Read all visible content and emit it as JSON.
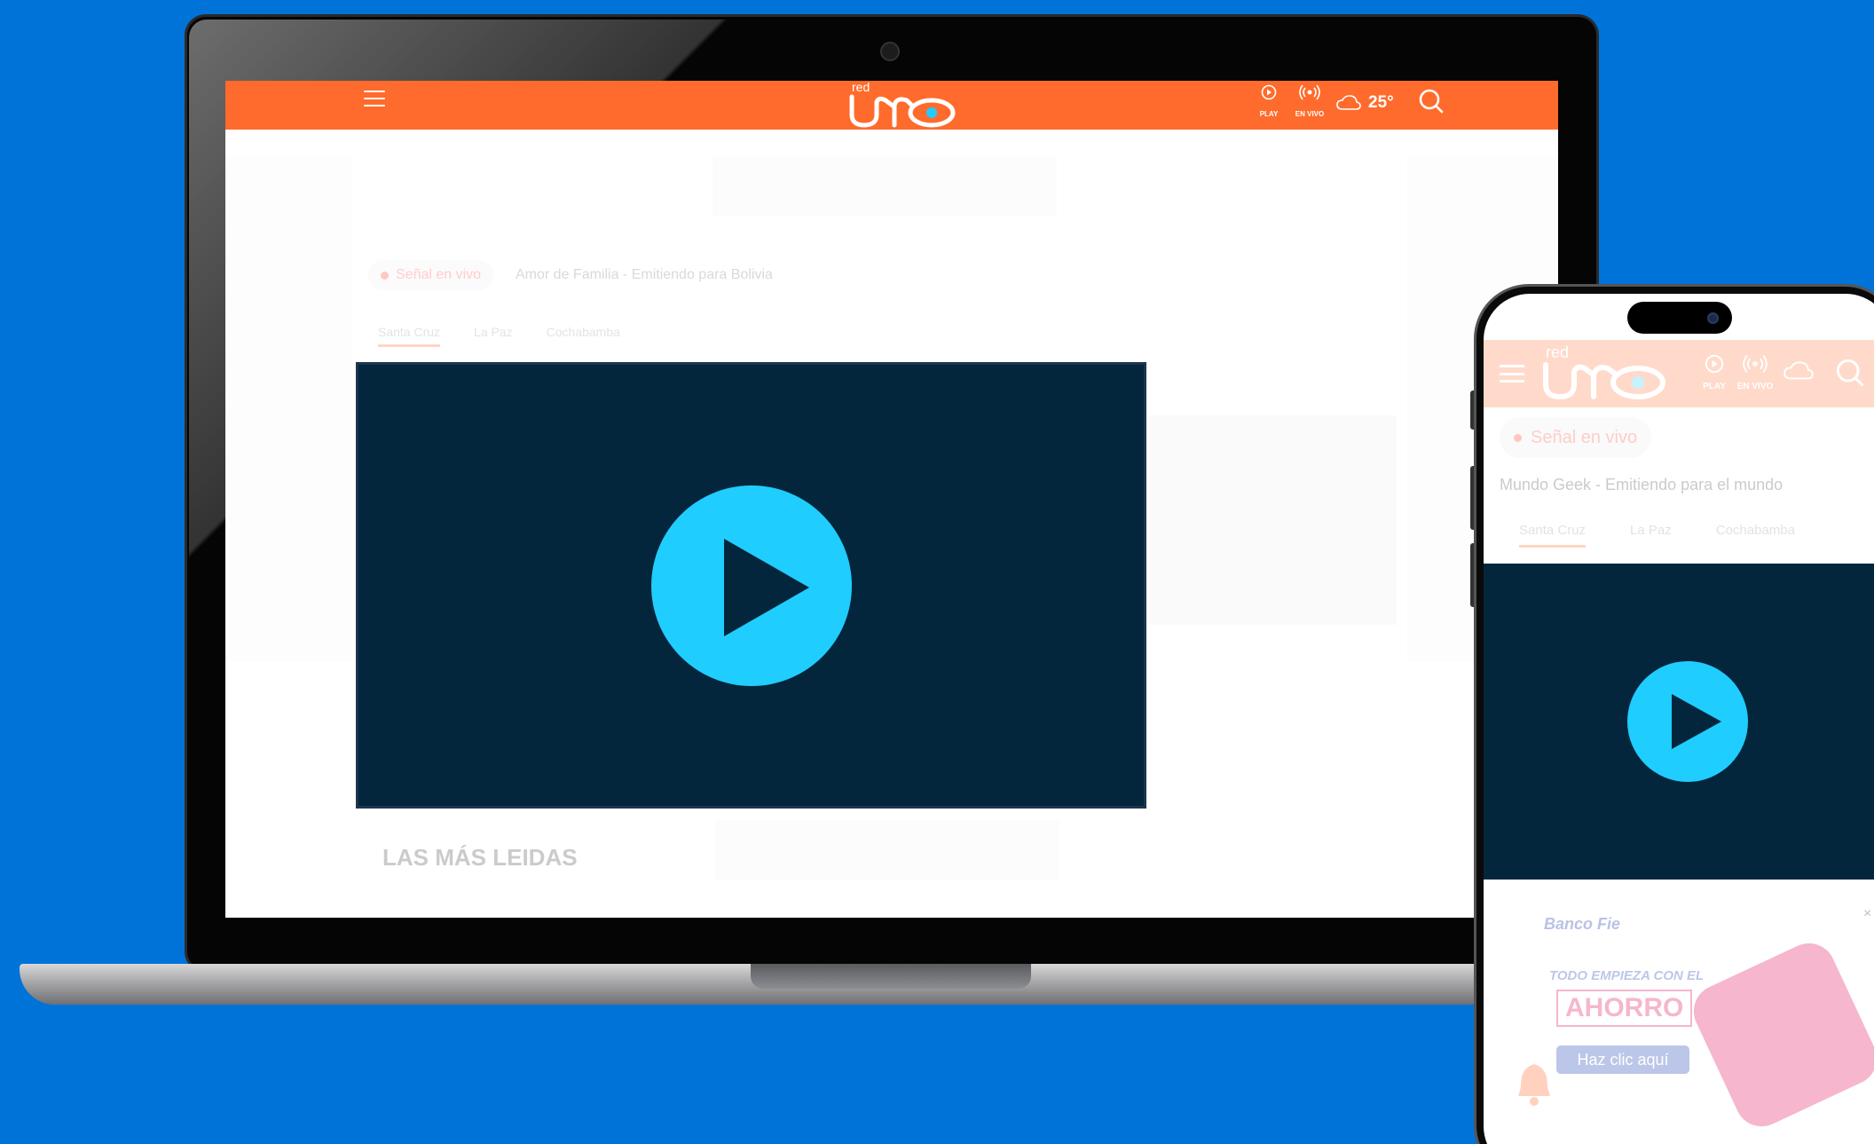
{
  "site": {
    "logo_top": "red",
    "logo_main": "uno",
    "nav": {
      "play_label": "PLAY",
      "live_label": "EN VIVO",
      "temperature": "25°"
    }
  },
  "desktop": {
    "live_badge": "Señal en vivo",
    "live_program": "Amor de Familia - Emitiendo para Bolivia",
    "city_tabs": [
      "Santa Cruz",
      "La Paz",
      "Cochabamba"
    ],
    "section_title": "LAS MÁS LEIDAS"
  },
  "mobile": {
    "live_badge": "Señal en vivo",
    "live_program": "Mundo Geek - Emitiendo para el mundo",
    "city_tabs": [
      "Santa Cruz",
      "La Paz",
      "Cochabamba"
    ],
    "ad": {
      "brand": "Banco Fie",
      "line": "TODO EMPIEZA CON EL",
      "headline": "AHORRO",
      "cta": "Haz clic aquí",
      "close": "×"
    }
  },
  "colors": {
    "background": "#0073d9",
    "header": "#ff6b2c",
    "player": "#03263c",
    "play_button": "#1fcdff"
  },
  "icons": [
    "menu-icon",
    "play-circle-icon",
    "broadcast-icon",
    "cloud-icon",
    "search-icon",
    "play-icon",
    "bell-icon",
    "close-icon"
  ]
}
